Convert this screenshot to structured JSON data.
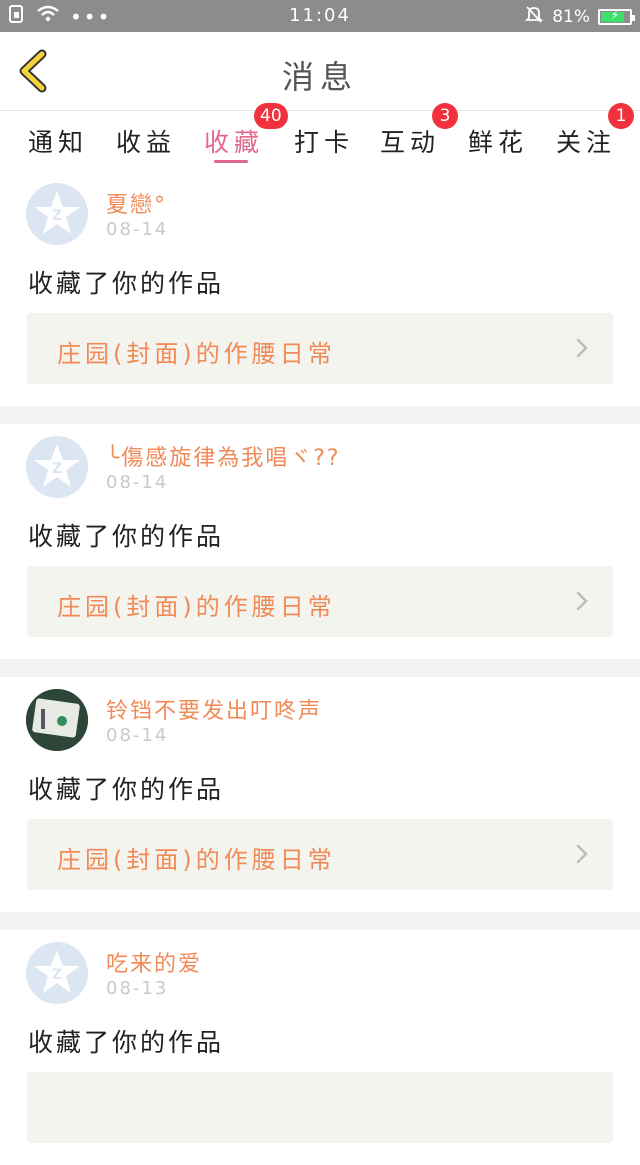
{
  "status_bar": {
    "time": "11:04",
    "battery": "81%",
    "battery_level": 0.81
  },
  "header": {
    "title": "消息"
  },
  "tabs": [
    {
      "label": "通知",
      "badge": ""
    },
    {
      "label": "收益",
      "badge": ""
    },
    {
      "label": "收藏",
      "badge": "40",
      "active": true
    },
    {
      "label": "打卡",
      "badge": ""
    },
    {
      "label": "互动",
      "badge": "3"
    },
    {
      "label": "鲜花",
      "badge": ""
    },
    {
      "label": "关注",
      "badge": "1"
    }
  ],
  "feed": [
    {
      "user": "夏戀°",
      "date": "08-14",
      "action": "收藏了你的作品",
      "work": "庄园(封面)的作腰日常",
      "avatar": "default-qq-icon"
    },
    {
      "user": "╰傷感旋律為我唱ヾ??",
      "date": "08-14",
      "action": "收藏了你的作品",
      "work": "庄园(封面)的作腰日常",
      "avatar": "default-qq-icon"
    },
    {
      "user": "铃铛不要发出叮咚声",
      "date": "08-14",
      "action": "收藏了你的作品",
      "work": "庄园(封面)的作腰日常",
      "avatar": "photo-avatar"
    },
    {
      "user": "吃来的爱",
      "date": "08-13",
      "action": "收藏了你的作品",
      "work": "",
      "avatar": "default-qq-icon"
    }
  ],
  "colors": {
    "accent": "#e2698d",
    "name": "#f08a57",
    "badge": "#f1313d",
    "back_arrow": "#f5d33a"
  }
}
